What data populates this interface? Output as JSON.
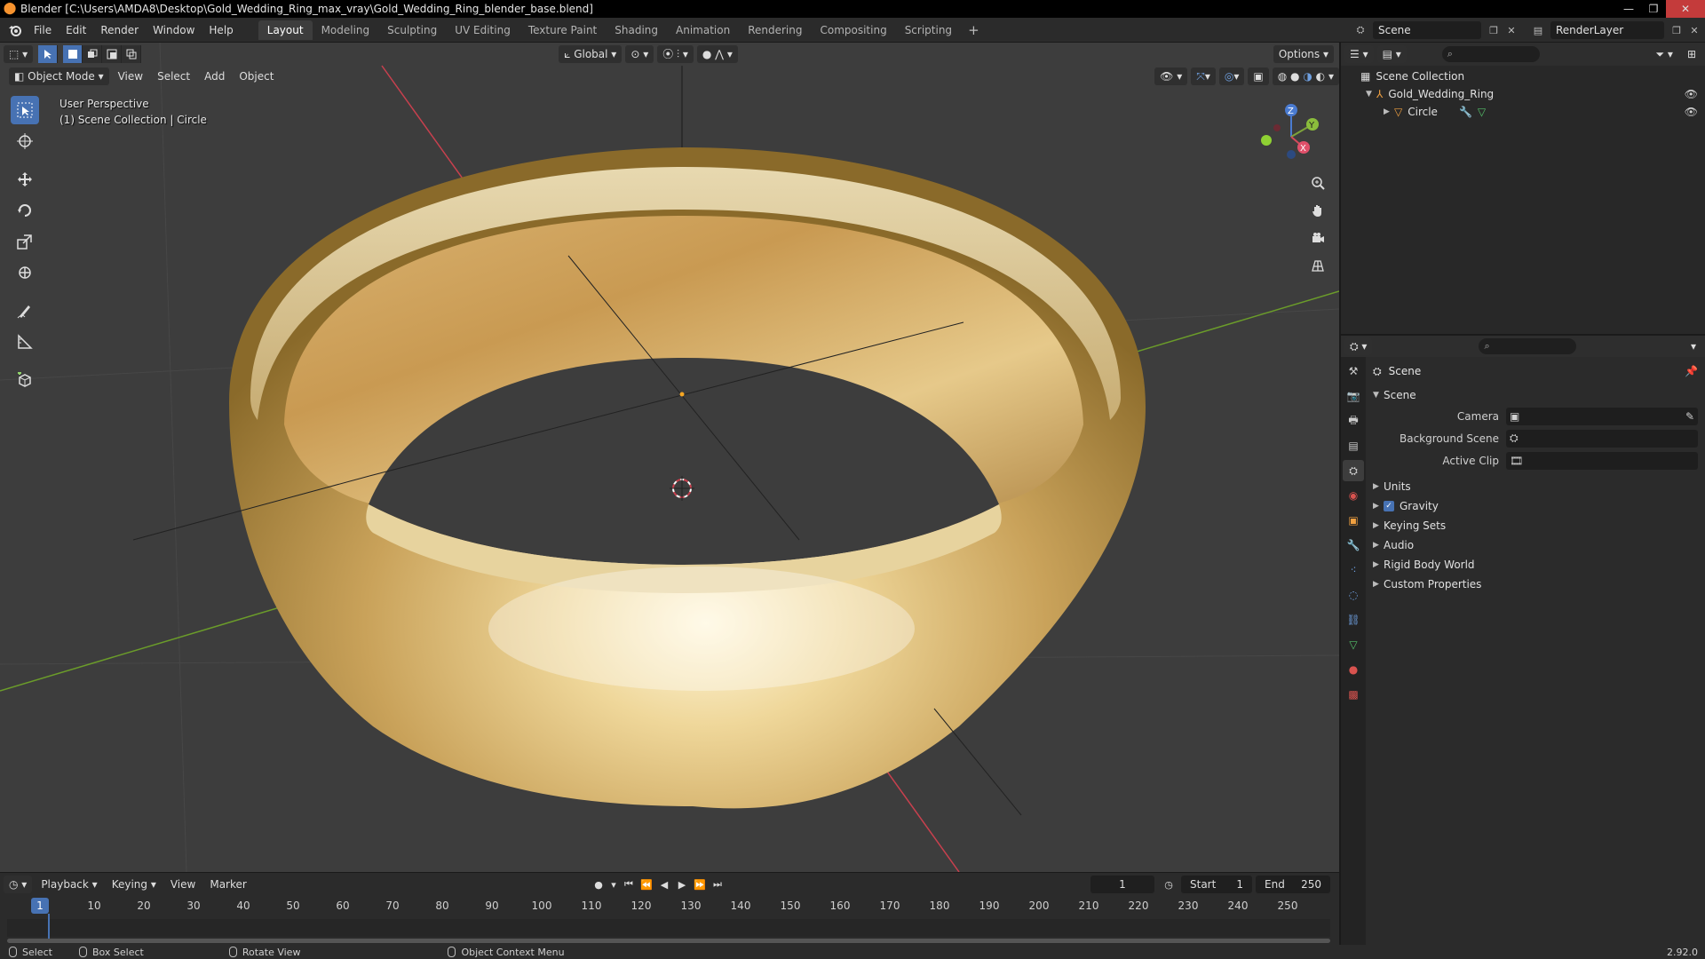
{
  "window": {
    "title": "Blender [C:\\Users\\AMDA8\\Desktop\\Gold_Wedding_Ring_max_vray\\Gold_Wedding_Ring_blender_base.blend]",
    "minimize": "—",
    "maximize": "❐",
    "close": "✕"
  },
  "menu": [
    "File",
    "Edit",
    "Render",
    "Window",
    "Help"
  ],
  "workspaces": {
    "tabs": [
      "Layout",
      "Modeling",
      "Sculpting",
      "UV Editing",
      "Texture Paint",
      "Shading",
      "Animation",
      "Rendering",
      "Compositing",
      "Scripting"
    ],
    "active": "Layout",
    "add": "+"
  },
  "scene_selector": {
    "value": "Scene"
  },
  "layer_selector": {
    "value": "RenderLayer"
  },
  "viewport": {
    "mode": "Object Mode",
    "menus": [
      "View",
      "Select",
      "Add",
      "Object"
    ],
    "transform_orientation": "Global",
    "options": "Options",
    "perspective_label": "User Perspective",
    "collection_label": "(1) Scene Collection | Circle",
    "gizmo": {
      "x": "X",
      "y": "Y",
      "z": "Z"
    }
  },
  "timeline": {
    "menus": [
      "Playback",
      "Keying",
      "View",
      "Marker"
    ],
    "current_frame": "1",
    "start_label": "Start",
    "start_value": "1",
    "end_label": "End",
    "end_value": "250",
    "ruler_current": "1",
    "ruler_marks": [
      "10",
      "20",
      "30",
      "40",
      "50",
      "60",
      "70",
      "80",
      "90",
      "100",
      "110",
      "120",
      "130",
      "140",
      "150",
      "160",
      "170",
      "180",
      "190",
      "200",
      "210",
      "220",
      "230",
      "240",
      "250"
    ]
  },
  "status": {
    "select": "Select",
    "box_select": "Box Select",
    "rotate_view": "Rotate View",
    "context_menu": "Object Context Menu",
    "version": "2.92.0"
  },
  "outliner": {
    "root": "Scene Collection",
    "collection": "Gold_Wedding_Ring",
    "object": "Circle"
  },
  "properties": {
    "context": "Scene",
    "panel_scene": "Scene",
    "fields": {
      "camera_label": "Camera",
      "background_scene_label": "Background Scene",
      "active_clip_label": "Active Clip"
    },
    "panels": [
      "Units",
      "Gravity",
      "Keying Sets",
      "Audio",
      "Rigid Body World",
      "Custom Properties"
    ],
    "gravity_checked": true
  },
  "colors": {
    "accent": "#4772b3",
    "viewport_bg": "#3d3d3d",
    "axis_x": "#c8404e",
    "axis_y": "#6b9c2a",
    "gold_light": "#f4e6b8",
    "gold_dark": "#8a6a2a"
  }
}
